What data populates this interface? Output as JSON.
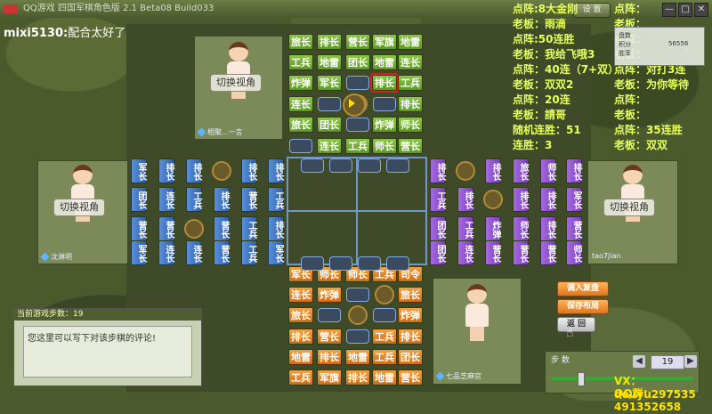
{
  "window": {
    "title": "QQ游戏 四国军棋角色版 2.1 Beta08 Build033",
    "settings_label": "设 置",
    "min_label": "—",
    "max_label": "□",
    "close_label": "✕"
  },
  "chat": {
    "user": "mixi5130:",
    "message": "配合太好了这把"
  },
  "board": {
    "top_rows": [
      [
        "旅长",
        "排长",
        "营长",
        "军旗",
        "地雷"
      ],
      [
        "工兵",
        "地雷",
        "团长",
        "地雷",
        "连长"
      ],
      [
        "炸弹",
        "军长",
        "",
        "排长",
        "工兵"
      ],
      [
        "连长",
        "",
        "",
        "",
        "排长"
      ],
      [
        "旅长",
        "团长",
        "",
        "炸弹",
        "师长"
      ],
      [
        "",
        "连长",
        "工兵",
        "师长",
        "营长"
      ]
    ],
    "bottom_rows": [
      [
        "军长",
        "师长",
        "师长",
        "工兵",
        "司令"
      ],
      [
        "连长",
        "炸弹",
        "",
        "",
        "旅长"
      ],
      [
        "旅长",
        "",
        "",
        "",
        "炸弹"
      ],
      [
        "排长",
        "营长",
        "",
        "工兵",
        "排长"
      ],
      [
        "地雷",
        "排长",
        "地雷",
        "工兵",
        "团长"
      ],
      [
        "工兵",
        "军旗",
        "排长",
        "地雷",
        "营长"
      ]
    ],
    "left_cols": [
      [
        "军长",
        "团长",
        "营长",
        "军长"
      ],
      [
        "排长",
        "连长",
        "营长",
        "连长"
      ],
      [
        "排长",
        "工兵",
        "",
        "连长"
      ],
      [
        "",
        "排长",
        "营长",
        "营长"
      ],
      [
        "排长",
        "营长",
        "工兵",
        "工兵"
      ],
      [
        "排长",
        "工兵",
        "排长",
        "军长"
      ]
    ],
    "right_cols": [
      [
        "排长",
        "工兵",
        "团长",
        "团长"
      ],
      [
        "",
        "排长",
        "工兵",
        "连长"
      ],
      [
        "排长",
        "",
        "炸弹",
        "营长"
      ],
      [
        "旅长",
        "排长",
        "师长",
        "营长"
      ],
      [
        "师长",
        "排长",
        "排长",
        "营长"
      ],
      [
        "排长",
        "军长",
        "营长",
        "师长"
      ]
    ]
  },
  "players": {
    "top": {
      "switch_label": "切换视角",
      "name": "相聚...一言"
    },
    "left": {
      "switch_label": "切换视角",
      "name": "沈淋明"
    },
    "right": {
      "switch_label": "切换视角",
      "name": "tao7jian"
    },
    "bottom": {
      "name": "七品芝麻官"
    }
  },
  "status_left": [
    "点阵:8大金刚",
    "老板：雨滴",
    "点阵:50连胜",
    "老板：我给飞哦3",
    "点阵：40连（7+双）",
    "老板：双双2",
    "点阵：20连",
    "老板：請哥",
    "随机连胜：51",
    "连胜：3"
  ],
  "status_right": [
    "点阵：",
    "老板：",
    "点阵：",
    "老板：",
    "点阵：对打3连",
    "老板：为你等待",
    "点阵：",
    "老板：",
    "点阵：35连胜",
    "老板：双双"
  ],
  "score": {
    "label1": "盘数",
    "label2": "积分",
    "value": "56556",
    "label3": "胜率"
  },
  "actions": {
    "load": "调入复盘",
    "save": "保存布局",
    "other": "返 回"
  },
  "move_log": {
    "header": "当前游戏步数：19",
    "comment": "您这里可以写下对该步棋的评论!"
  },
  "step": {
    "label": "步  数",
    "value": "19",
    "prev": "◀",
    "next": "▶"
  },
  "contact": {
    "vx": "VX：douyu297535",
    "qq": "QQ群：491352658"
  }
}
